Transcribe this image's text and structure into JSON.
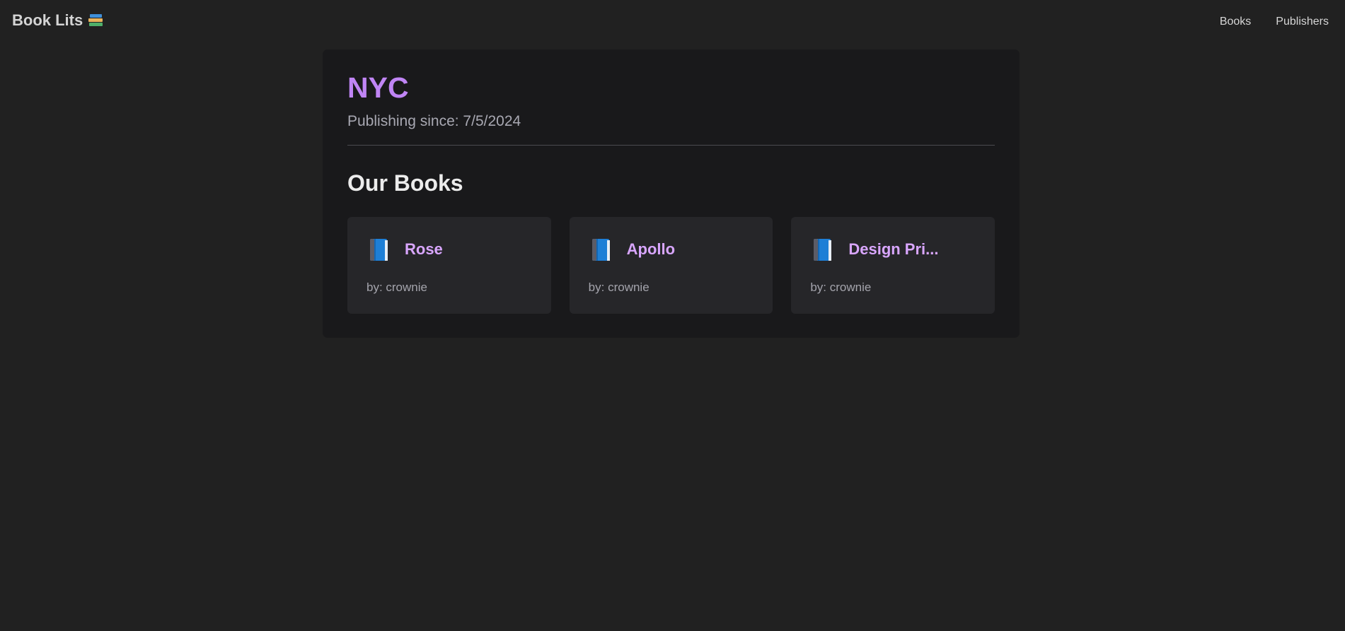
{
  "header": {
    "brand": "Book Lits",
    "brand_icon": "books-stack-icon",
    "nav": [
      {
        "label": "Books"
      },
      {
        "label": "Publishers"
      }
    ]
  },
  "publisher": {
    "name": "NYC",
    "since_text": "Publishing since: 7/5/2024"
  },
  "section": {
    "title": "Our Books"
  },
  "books": [
    {
      "title": "Rose",
      "author": "by: crownie",
      "icon": "blue-book-icon"
    },
    {
      "title": "Apollo",
      "author": "by: crownie",
      "icon": "blue-book-icon"
    },
    {
      "title": "Design Pri...",
      "author": "by: crownie",
      "icon": "blue-book-icon"
    }
  ],
  "colors": {
    "background": "#212121",
    "panel": "#19191b",
    "card": "#262629",
    "accent": "#c085f5",
    "book_title": "#d9a6ff"
  }
}
